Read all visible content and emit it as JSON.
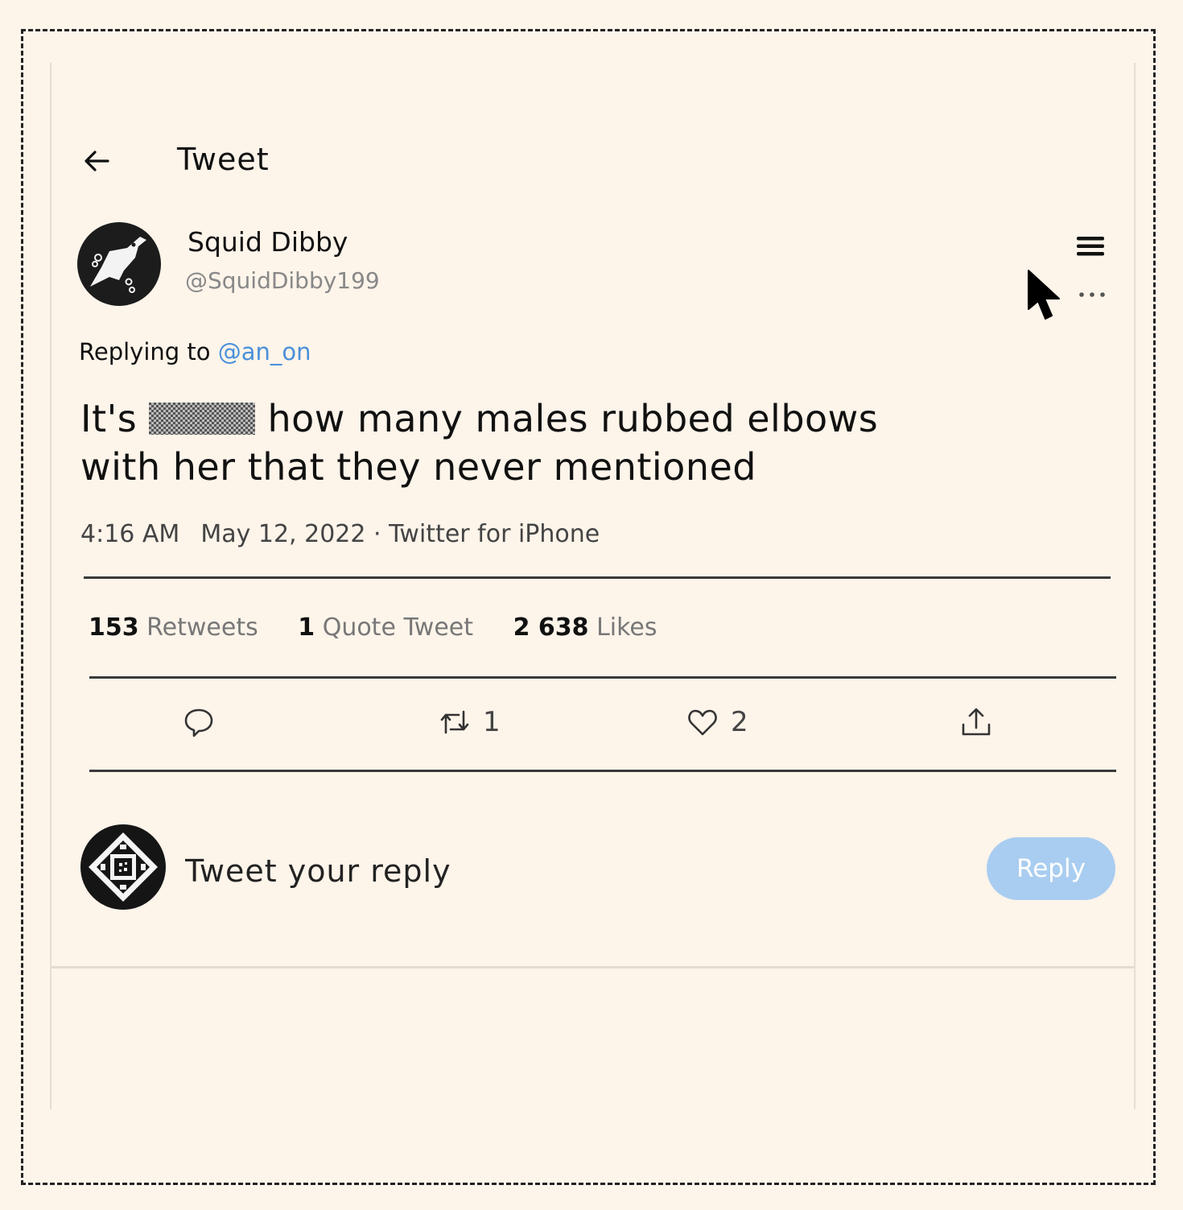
{
  "header": {
    "title": "Tweet"
  },
  "tweet": {
    "author": {
      "display_name": "Squid Dibby",
      "handle": "@SquidDibby199"
    },
    "replying_to_prefix": "Replying to",
    "replying_to_handle": "@an_on",
    "text_before": "It's",
    "text_after": " how many males rubbed elbows with her that they never mentioned",
    "time": "4:16 AM",
    "date_source": "May 12, 2022 · Twitter for iPhone"
  },
  "stats": {
    "retweets_count": "153",
    "retweets_label": "Retweets",
    "quotes_count": "1",
    "quotes_label": "Quote Tweet",
    "likes_count": "2 638",
    "likes_label": "Likes"
  },
  "actions": {
    "retweet_count": "1",
    "like_count": "2"
  },
  "reply": {
    "placeholder": "Tweet your reply",
    "button_label": "Reply"
  },
  "icons": [
    "back-arrow-icon",
    "menu-icon",
    "more-icon",
    "cursor-icon",
    "reply-icon",
    "retweet-icon",
    "like-icon",
    "share-icon"
  ],
  "colors": {
    "mention": "#4a90d9",
    "reply_button": "#a9cdf0",
    "background": "#fdf4ea"
  }
}
